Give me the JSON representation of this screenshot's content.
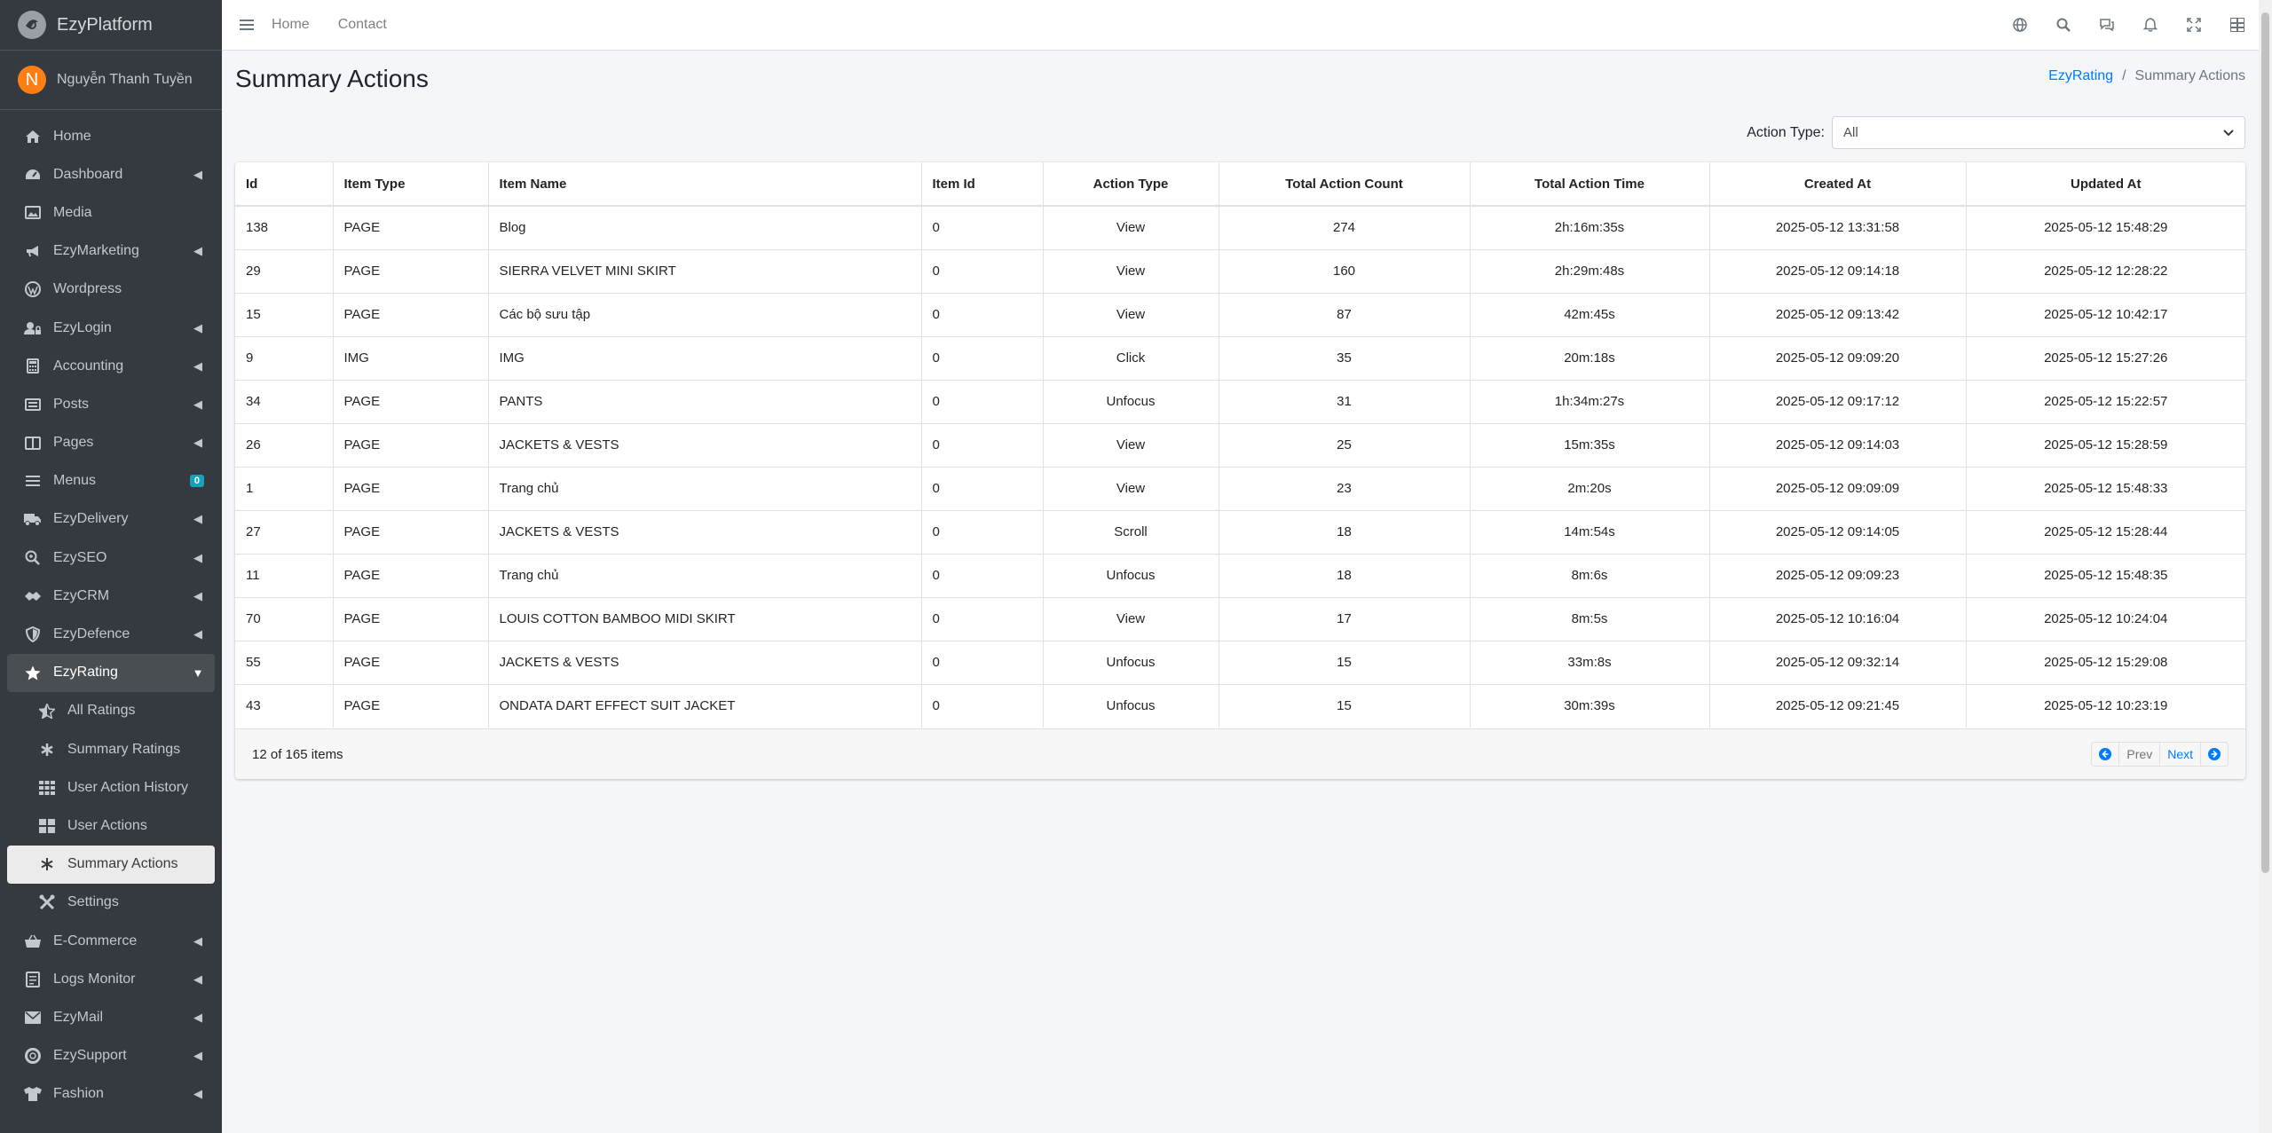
{
  "brand": {
    "name": "EzyPlatform"
  },
  "user": {
    "initial": "N",
    "name": "Nguyễn Thanh Tuyền"
  },
  "sidebar": {
    "items": [
      {
        "label": "Home",
        "icon": "home-icon"
      },
      {
        "label": "Dashboard",
        "icon": "dashboard-icon"
      },
      {
        "label": "Media",
        "icon": "image-icon"
      },
      {
        "label": "EzyMarketing",
        "icon": "megaphone-icon"
      },
      {
        "label": "Wordpress",
        "icon": "wordpress-icon"
      },
      {
        "label": "EzyLogin",
        "icon": "user-lock-icon"
      },
      {
        "label": "Accounting",
        "icon": "calculator-icon"
      },
      {
        "label": "Posts",
        "icon": "newspaper-icon"
      },
      {
        "label": "Pages",
        "icon": "columns-icon"
      },
      {
        "label": "Menus",
        "icon": "bars-icon",
        "badge": "0"
      },
      {
        "label": "EzyDelivery",
        "icon": "truck-icon"
      },
      {
        "label": "EzySEO",
        "icon": "search-plus-icon"
      },
      {
        "label": "EzyCRM",
        "icon": "crm-icon"
      },
      {
        "label": "EzyDefence",
        "icon": "shield-icon"
      },
      {
        "label": "EzyRating",
        "icon": "star-icon"
      },
      {
        "label": "All Ratings",
        "icon": "star-half-icon"
      },
      {
        "label": "Summary Ratings",
        "icon": "asterisk-icon"
      },
      {
        "label": "User Action History",
        "icon": "table-icon"
      },
      {
        "label": "User Actions",
        "icon": "grid-icon"
      },
      {
        "label": "Summary Actions",
        "icon": "snowflake-icon"
      },
      {
        "label": "Settings",
        "icon": "tools-icon"
      },
      {
        "label": "E-Commerce",
        "icon": "basket-icon"
      },
      {
        "label": "Logs Monitor",
        "icon": "logs-icon"
      },
      {
        "label": "EzyMail",
        "icon": "envelope-icon"
      },
      {
        "label": "EzySupport",
        "icon": "lifering-icon"
      },
      {
        "label": "Fashion",
        "icon": "shirt-icon"
      }
    ]
  },
  "topbar": {
    "links": [
      "Home",
      "Contact"
    ],
    "icons": [
      "globe-icon",
      "search-icon",
      "comments-icon",
      "bell-icon",
      "expand-icon",
      "apps-icon"
    ]
  },
  "page": {
    "title": "Summary Actions",
    "breadcrumb": {
      "parent": "EzyRating",
      "separator": "/",
      "current": "Summary Actions"
    }
  },
  "filter": {
    "label": "Action Type:",
    "value": "All"
  },
  "table": {
    "headers": [
      "Id",
      "Item Type",
      "Item Name",
      "Item Id",
      "Action Type",
      "Total Action Count",
      "Total Action Time",
      "Created At",
      "Updated At"
    ],
    "rows": [
      [
        "138",
        "PAGE",
        "Blog",
        "0",
        "View",
        "274",
        "2h:16m:35s",
        "2025-05-12 13:31:58",
        "2025-05-12 15:48:29"
      ],
      [
        "29",
        "PAGE",
        "SIERRA VELVET MINI SKIRT",
        "0",
        "View",
        "160",
        "2h:29m:48s",
        "2025-05-12 09:14:18",
        "2025-05-12 12:28:22"
      ],
      [
        "15",
        "PAGE",
        "Các bộ sưu tập",
        "0",
        "View",
        "87",
        "42m:45s",
        "2025-05-12 09:13:42",
        "2025-05-12 10:42:17"
      ],
      [
        "9",
        "IMG",
        "IMG",
        "0",
        "Click",
        "35",
        "20m:18s",
        "2025-05-12 09:09:20",
        "2025-05-12 15:27:26"
      ],
      [
        "34",
        "PAGE",
        "PANTS",
        "0",
        "Unfocus",
        "31",
        "1h:34m:27s",
        "2025-05-12 09:17:12",
        "2025-05-12 15:22:57"
      ],
      [
        "26",
        "PAGE",
        "JACKETS & VESTS",
        "0",
        "View",
        "25",
        "15m:35s",
        "2025-05-12 09:14:03",
        "2025-05-12 15:28:59"
      ],
      [
        "1",
        "PAGE",
        "Trang chủ",
        "0",
        "View",
        "23",
        "2m:20s",
        "2025-05-12 09:09:09",
        "2025-05-12 15:48:33"
      ],
      [
        "27",
        "PAGE",
        "JACKETS & VESTS",
        "0",
        "Scroll",
        "18",
        "14m:54s",
        "2025-05-12 09:14:05",
        "2025-05-12 15:28:44"
      ],
      [
        "11",
        "PAGE",
        "Trang chủ",
        "0",
        "Unfocus",
        "18",
        "8m:6s",
        "2025-05-12 09:09:23",
        "2025-05-12 15:48:35"
      ],
      [
        "70",
        "PAGE",
        "LOUIS COTTON BAMBOO MIDI SKIRT",
        "0",
        "View",
        "17",
        "8m:5s",
        "2025-05-12 10:16:04",
        "2025-05-12 10:24:04"
      ],
      [
        "55",
        "PAGE",
        "JACKETS & VESTS",
        "0",
        "Unfocus",
        "15",
        "33m:8s",
        "2025-05-12 09:32:14",
        "2025-05-12 15:29:08"
      ],
      [
        "43",
        "PAGE",
        "ONDATA DART EFFECT SUIT JACKET",
        "0",
        "Unfocus",
        "15",
        "30m:39s",
        "2025-05-12 09:21:45",
        "2025-05-12 10:23:19"
      ]
    ]
  },
  "footer": {
    "summary": "12 of 165 items",
    "prev": "Prev",
    "next": "Next"
  },
  "colors": {
    "sidebar": "#343a40",
    "accent": "#007bff",
    "badge": "#17a2b8",
    "avatar": "#fd7e14"
  }
}
